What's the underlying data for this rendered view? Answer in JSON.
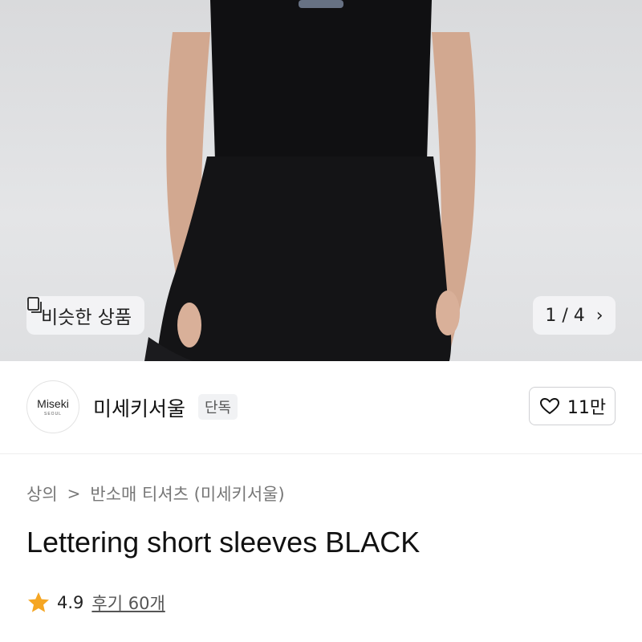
{
  "hero": {
    "similar_label": "비슷한 상품",
    "page_counter": "1 / 4",
    "chevron": "›"
  },
  "brand": {
    "logo_text": "Miseki",
    "logo_sub": "SEOUL",
    "name": "미세키서울",
    "badge": "단독",
    "like_count": "11만"
  },
  "product": {
    "breadcrumb": [
      "상의",
      "반소매 티셔츠 (미세키서울)"
    ],
    "breadcrumb_sep": ">",
    "title": "Lettering short sleeves BLACK",
    "rating": "4.9",
    "reviews": "후기 60개"
  },
  "colors": {
    "star": "#f5a623",
    "border": "#cfd0d3",
    "badge_bg": "#f1f2f4"
  },
  "icons": [
    "copy-icon",
    "chevron-right-icon",
    "heart-icon",
    "star-icon"
  ]
}
